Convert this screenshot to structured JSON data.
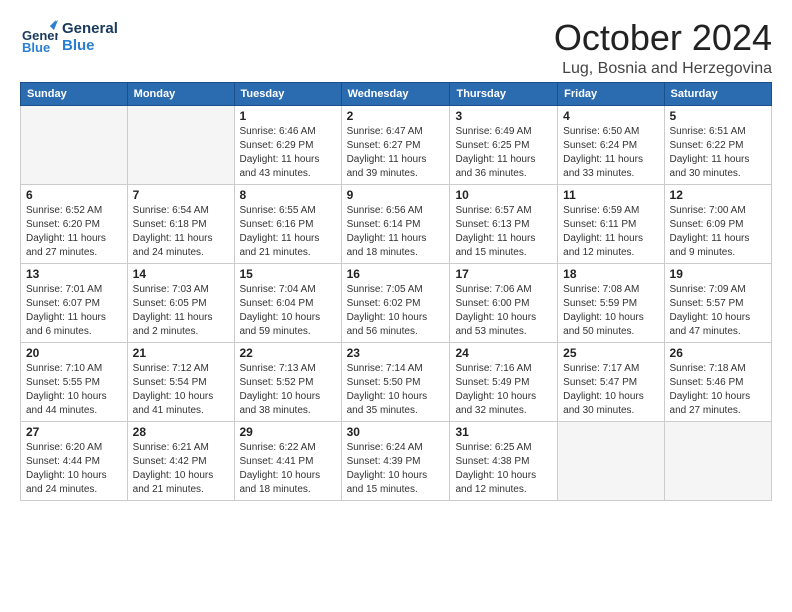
{
  "header": {
    "logo_general": "General",
    "logo_blue": "Blue",
    "month": "October 2024",
    "location": "Lug, Bosnia and Herzegovina"
  },
  "days_of_week": [
    "Sunday",
    "Monday",
    "Tuesday",
    "Wednesday",
    "Thursday",
    "Friday",
    "Saturday"
  ],
  "weeks": [
    [
      {
        "day": "",
        "info": "",
        "empty": true
      },
      {
        "day": "",
        "info": "",
        "empty": true
      },
      {
        "day": "1",
        "info": "Sunrise: 6:46 AM\nSunset: 6:29 PM\nDaylight: 11 hours and 43 minutes.",
        "empty": false
      },
      {
        "day": "2",
        "info": "Sunrise: 6:47 AM\nSunset: 6:27 PM\nDaylight: 11 hours and 39 minutes.",
        "empty": false
      },
      {
        "day": "3",
        "info": "Sunrise: 6:49 AM\nSunset: 6:25 PM\nDaylight: 11 hours and 36 minutes.",
        "empty": false
      },
      {
        "day": "4",
        "info": "Sunrise: 6:50 AM\nSunset: 6:24 PM\nDaylight: 11 hours and 33 minutes.",
        "empty": false
      },
      {
        "day": "5",
        "info": "Sunrise: 6:51 AM\nSunset: 6:22 PM\nDaylight: 11 hours and 30 minutes.",
        "empty": false
      }
    ],
    [
      {
        "day": "6",
        "info": "Sunrise: 6:52 AM\nSunset: 6:20 PM\nDaylight: 11 hours and 27 minutes.",
        "empty": false
      },
      {
        "day": "7",
        "info": "Sunrise: 6:54 AM\nSunset: 6:18 PM\nDaylight: 11 hours and 24 minutes.",
        "empty": false
      },
      {
        "day": "8",
        "info": "Sunrise: 6:55 AM\nSunset: 6:16 PM\nDaylight: 11 hours and 21 minutes.",
        "empty": false
      },
      {
        "day": "9",
        "info": "Sunrise: 6:56 AM\nSunset: 6:14 PM\nDaylight: 11 hours and 18 minutes.",
        "empty": false
      },
      {
        "day": "10",
        "info": "Sunrise: 6:57 AM\nSunset: 6:13 PM\nDaylight: 11 hours and 15 minutes.",
        "empty": false
      },
      {
        "day": "11",
        "info": "Sunrise: 6:59 AM\nSunset: 6:11 PM\nDaylight: 11 hours and 12 minutes.",
        "empty": false
      },
      {
        "day": "12",
        "info": "Sunrise: 7:00 AM\nSunset: 6:09 PM\nDaylight: 11 hours and 9 minutes.",
        "empty": false
      }
    ],
    [
      {
        "day": "13",
        "info": "Sunrise: 7:01 AM\nSunset: 6:07 PM\nDaylight: 11 hours and 6 minutes.",
        "empty": false
      },
      {
        "day": "14",
        "info": "Sunrise: 7:03 AM\nSunset: 6:05 PM\nDaylight: 11 hours and 2 minutes.",
        "empty": false
      },
      {
        "day": "15",
        "info": "Sunrise: 7:04 AM\nSunset: 6:04 PM\nDaylight: 10 hours and 59 minutes.",
        "empty": false
      },
      {
        "day": "16",
        "info": "Sunrise: 7:05 AM\nSunset: 6:02 PM\nDaylight: 10 hours and 56 minutes.",
        "empty": false
      },
      {
        "day": "17",
        "info": "Sunrise: 7:06 AM\nSunset: 6:00 PM\nDaylight: 10 hours and 53 minutes.",
        "empty": false
      },
      {
        "day": "18",
        "info": "Sunrise: 7:08 AM\nSunset: 5:59 PM\nDaylight: 10 hours and 50 minutes.",
        "empty": false
      },
      {
        "day": "19",
        "info": "Sunrise: 7:09 AM\nSunset: 5:57 PM\nDaylight: 10 hours and 47 minutes.",
        "empty": false
      }
    ],
    [
      {
        "day": "20",
        "info": "Sunrise: 7:10 AM\nSunset: 5:55 PM\nDaylight: 10 hours and 44 minutes.",
        "empty": false
      },
      {
        "day": "21",
        "info": "Sunrise: 7:12 AM\nSunset: 5:54 PM\nDaylight: 10 hours and 41 minutes.",
        "empty": false
      },
      {
        "day": "22",
        "info": "Sunrise: 7:13 AM\nSunset: 5:52 PM\nDaylight: 10 hours and 38 minutes.",
        "empty": false
      },
      {
        "day": "23",
        "info": "Sunrise: 7:14 AM\nSunset: 5:50 PM\nDaylight: 10 hours and 35 minutes.",
        "empty": false
      },
      {
        "day": "24",
        "info": "Sunrise: 7:16 AM\nSunset: 5:49 PM\nDaylight: 10 hours and 32 minutes.",
        "empty": false
      },
      {
        "day": "25",
        "info": "Sunrise: 7:17 AM\nSunset: 5:47 PM\nDaylight: 10 hours and 30 minutes.",
        "empty": false
      },
      {
        "day": "26",
        "info": "Sunrise: 7:18 AM\nSunset: 5:46 PM\nDaylight: 10 hours and 27 minutes.",
        "empty": false
      }
    ],
    [
      {
        "day": "27",
        "info": "Sunrise: 6:20 AM\nSunset: 4:44 PM\nDaylight: 10 hours and 24 minutes.",
        "empty": false
      },
      {
        "day": "28",
        "info": "Sunrise: 6:21 AM\nSunset: 4:42 PM\nDaylight: 10 hours and 21 minutes.",
        "empty": false
      },
      {
        "day": "29",
        "info": "Sunrise: 6:22 AM\nSunset: 4:41 PM\nDaylight: 10 hours and 18 minutes.",
        "empty": false
      },
      {
        "day": "30",
        "info": "Sunrise: 6:24 AM\nSunset: 4:39 PM\nDaylight: 10 hours and 15 minutes.",
        "empty": false
      },
      {
        "day": "31",
        "info": "Sunrise: 6:25 AM\nSunset: 4:38 PM\nDaylight: 10 hours and 12 minutes.",
        "empty": false
      },
      {
        "day": "",
        "info": "",
        "empty": true
      },
      {
        "day": "",
        "info": "",
        "empty": true
      }
    ]
  ]
}
